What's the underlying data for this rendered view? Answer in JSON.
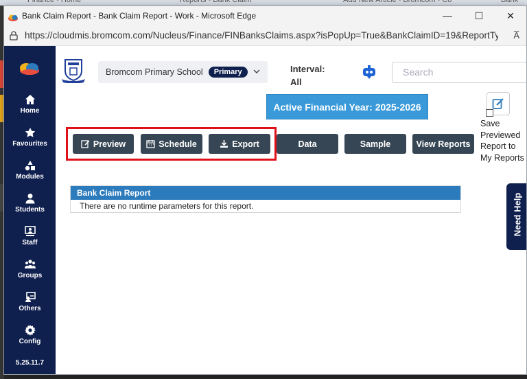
{
  "background_tabs": [
    "Finance - Home",
    "Reports - Bank Claim",
    "Add New Article - Bromcom - Co",
    "Bank"
  ],
  "window": {
    "title": "Bank Claim Report - Bank Claim Report - Work - Microsoft Edge",
    "url": "https://cloudmis.bromcom.com/Nucleus/Finance/FINBanksClaims.aspx?isPopUp=True&BankClaimID=19&ReportTyp...",
    "controls": {
      "minimize": "—",
      "maximize": "☐",
      "close": "✕"
    },
    "read_aloud": "A̅"
  },
  "sidebar": {
    "items": [
      {
        "label": "Home",
        "icon": "home-icon"
      },
      {
        "label": "Favourites",
        "icon": "star-icon"
      },
      {
        "label": "Modules",
        "icon": "modules-icon"
      },
      {
        "label": "Students",
        "icon": "user-icon"
      },
      {
        "label": "Staff",
        "icon": "staff-icon"
      },
      {
        "label": "Groups",
        "icon": "groups-icon"
      },
      {
        "label": "Others",
        "icon": "others-icon"
      },
      {
        "label": "Config",
        "icon": "gear-icon"
      }
    ],
    "version": "5.25.11.7"
  },
  "header": {
    "school_name": "Bromcom Primary School",
    "school_badge": "Primary",
    "interval_label": "Interval:",
    "interval_value": "All",
    "search_placeholder": "Search"
  },
  "financial_year": "Active Financial Year: 2025-2026",
  "buttons": {
    "preview": "Preview",
    "schedule": "Schedule",
    "export": "Export",
    "data": "Data",
    "sample": "Sample",
    "view_reports": "View Reports"
  },
  "save_option": {
    "label": "Save Previewed Report to My Reports",
    "checked": false
  },
  "need_help": "Need Help",
  "report": {
    "title": "Bank Claim Report",
    "message": "There are no runtime parameters for this report."
  },
  "colors": {
    "sidebar": "#0f1f4e",
    "banner": "#3a9ad9",
    "report_header": "#2c7bbd",
    "button": "#364655",
    "highlight": "#e0101a"
  }
}
